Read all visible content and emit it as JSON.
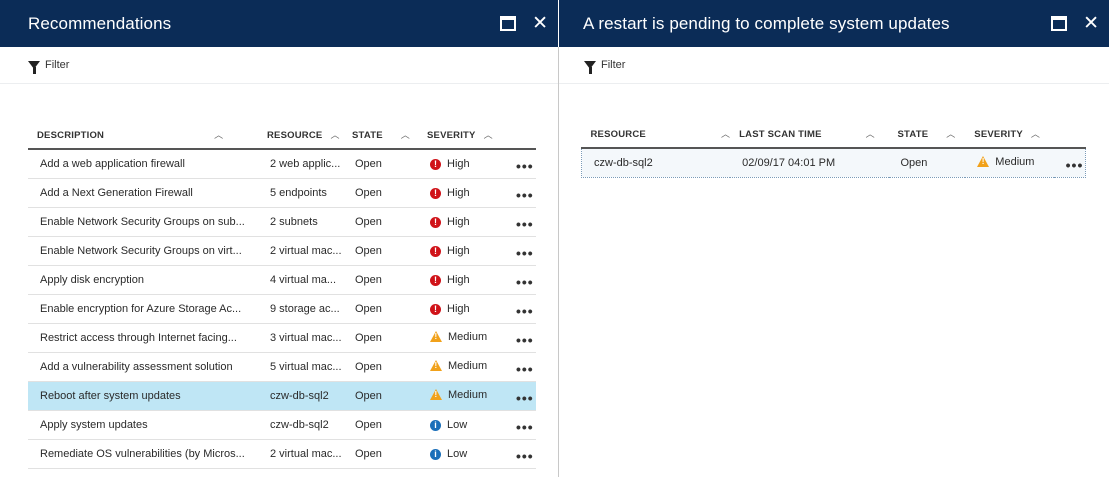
{
  "left_blade": {
    "title": "Recommendations",
    "filter_label": "Filter",
    "columns": [
      "DESCRIPTION",
      "RESOURCE",
      "STATE",
      "SEVERITY"
    ],
    "rows": [
      {
        "description": "Add a web application firewall",
        "resource": "2 web applic...",
        "state": "Open",
        "severity": "High",
        "severity_icon": "error-icon"
      },
      {
        "description": "Add a Next Generation Firewall",
        "resource": "5 endpoints",
        "state": "Open",
        "severity": "High",
        "severity_icon": "error-icon"
      },
      {
        "description": "Enable Network Security Groups on sub...",
        "resource": "2 subnets",
        "state": "Open",
        "severity": "High",
        "severity_icon": "error-icon"
      },
      {
        "description": "Enable Network Security Groups on virt...",
        "resource": "2 virtual mac...",
        "state": "Open",
        "severity": "High",
        "severity_icon": "error-icon"
      },
      {
        "description": "Apply disk encryption",
        "resource": "4 virtual ma...",
        "state": "Open",
        "severity": "High",
        "severity_icon": "error-icon"
      },
      {
        "description": "Enable encryption for Azure Storage Ac...",
        "resource": "9 storage ac...",
        "state": "Open",
        "severity": "High",
        "severity_icon": "error-icon"
      },
      {
        "description": "Restrict access through Internet facing...",
        "resource": "3 virtual mac...",
        "state": "Open",
        "severity": "Medium",
        "severity_icon": "warning-icon"
      },
      {
        "description": "Add a vulnerability assessment solution",
        "resource": "5 virtual mac...",
        "state": "Open",
        "severity": "Medium",
        "severity_icon": "warning-icon"
      },
      {
        "description": "Reboot after system updates",
        "resource": "czw-db-sql2",
        "state": "Open",
        "severity": "Medium",
        "severity_icon": "warning-icon"
      },
      {
        "description": "Apply system updates",
        "resource": "czw-db-sql2",
        "state": "Open",
        "severity": "Low",
        "severity_icon": "info-icon"
      },
      {
        "description": "Remediate OS vulnerabilities (by Micros...",
        "resource": "2 virtual mac...",
        "state": "Open",
        "severity": "Low",
        "severity_icon": "info-icon"
      }
    ]
  },
  "right_blade": {
    "title": "A restart is pending to complete system updates",
    "filter_label": "Filter",
    "columns": [
      "RESOURCE",
      "LAST SCAN TIME",
      "STATE",
      "SEVERITY"
    ],
    "rows": [
      {
        "resource": "czw-db-sql2",
        "last_scan_time": "02/09/17 04:01 PM",
        "state": "Open",
        "severity": "Medium",
        "severity_icon": "warning-icon"
      }
    ]
  },
  "icons": {
    "sort": "chevron-up-icon",
    "more": "ellipsis-icon",
    "maximize": "maximize-icon",
    "close": "close-icon",
    "filter": "filter-icon"
  },
  "colors": {
    "title_bar": "#0b2c57",
    "selected_row": "#bfe6f5",
    "high": "#d01319",
    "medium": "#f1a11a",
    "low": "#1a6fb9"
  }
}
